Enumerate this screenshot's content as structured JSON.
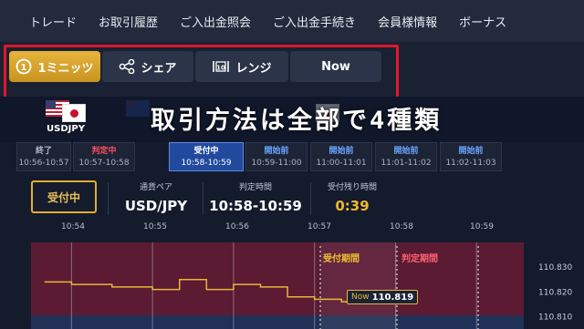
{
  "nav": [
    "トレード",
    "お取引履歴",
    "ご入出金照会",
    "ご入出金手続き",
    "会員様情報",
    "ボーナス"
  ],
  "tabs": [
    {
      "label": "1ミニッツ",
      "icon": "clock-icon",
      "active": true
    },
    {
      "label": "シェア",
      "icon": "share-icon",
      "active": false
    },
    {
      "label": "レンジ",
      "icon": "range-icon",
      "active": false
    },
    {
      "label": "Now",
      "icon": "",
      "active": false
    }
  ],
  "banner": {
    "title": "取引方法は全部で4種類"
  },
  "pair": {
    "code": "USDJPY"
  },
  "slots": [
    {
      "status": "終了",
      "time": "10:56-10:57",
      "state": "closed"
    },
    {
      "status": "判定中",
      "time": "10:57-10:58",
      "state": "judging"
    },
    {
      "status": "受付中",
      "time": "10:58-10:59",
      "state": "open"
    },
    {
      "status": "開始前",
      "time": "10:59-11:00",
      "state": "upcoming"
    },
    {
      "status": "開始前",
      "time": "11:00-11:01",
      "state": "upcoming"
    },
    {
      "status": "開始前",
      "time": "11:01-11:02",
      "state": "upcoming"
    },
    {
      "status": "開始前",
      "time": "11:02-11:03",
      "state": "upcoming"
    }
  ],
  "info": {
    "status_button": "受付中",
    "pair_label": "通貨ペア",
    "pair_value": "USD/JPY",
    "judge_label": "判定時間",
    "judge_value": "10:58-10:59",
    "remain_label": "受付残り時間",
    "remain_value": "0:39"
  },
  "chart": {
    "time_labels": [
      "10:54",
      "10:55",
      "10:56",
      "10:57",
      "10:58",
      "10:59"
    ],
    "accept_period": "受付期間",
    "judge_period": "判定期間",
    "now_label": "Now",
    "now_price": "110.819",
    "price_ticks": [
      "110.830",
      "110.820",
      "110.810"
    ]
  },
  "chart_data": {
    "type": "line",
    "x": [
      "10:53:40",
      "10:54:00",
      "10:54:30",
      "10:55:00",
      "10:55:20",
      "10:55:40",
      "10:56:00",
      "10:56:20",
      "10:56:40",
      "10:57:00",
      "10:57:20",
      "10:57:40",
      "10:57:55"
    ],
    "values": [
      110.824,
      110.823,
      110.822,
      110.821,
      110.825,
      110.821,
      110.823,
      110.822,
      110.818,
      110.817,
      110.816,
      110.818,
      110.819
    ],
    "yticks": [
      110.83,
      110.82,
      110.81
    ],
    "ylim": [
      110.805,
      110.84
    ],
    "colors": {
      "line": "#e6b637",
      "background_top": "#5e1d35",
      "background_bottom": "#21305a"
    }
  },
  "colors": {
    "gold": "#e6b637",
    "red_highlight": "#e0182d",
    "accent_blue": "#214a9e"
  }
}
